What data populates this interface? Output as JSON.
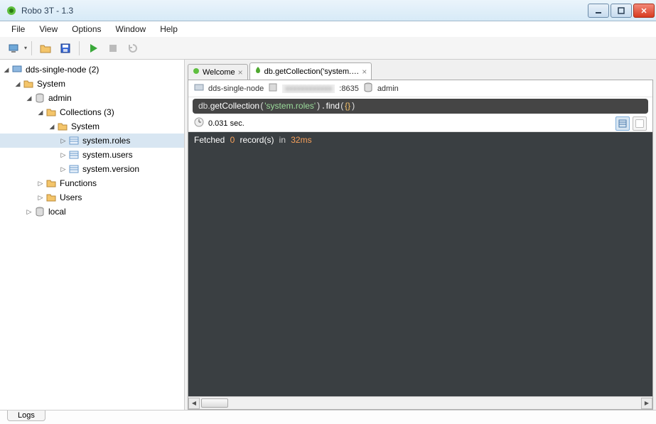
{
  "window": {
    "title": "Robo 3T - 1.3"
  },
  "menu": [
    "File",
    "View",
    "Options",
    "Window",
    "Help"
  ],
  "tree": {
    "root": {
      "label": "dds-single-node (2)"
    },
    "system": {
      "label": "System"
    },
    "admin": {
      "label": "admin"
    },
    "collections": {
      "label": "Collections (3)"
    },
    "system_folder": {
      "label": "System"
    },
    "coll_roles": {
      "label": "system.roles"
    },
    "coll_users": {
      "label": "system.users"
    },
    "coll_version": {
      "label": "system.version"
    },
    "functions": {
      "label": "Functions"
    },
    "users": {
      "label": "Users"
    },
    "local": {
      "label": "local"
    }
  },
  "tabs": {
    "welcome": "Welcome",
    "query": "db.getCollection('system.…"
  },
  "conn": {
    "host": "dds-single-node",
    "port": ":8635",
    "db": "admin"
  },
  "query": {
    "prefix": "db.",
    "fn": "getCollection",
    "arg": "'system.roles'",
    "fn2": "find",
    "arg2": "{}"
  },
  "status": {
    "time": "0.031 sec."
  },
  "result": {
    "word1": "Fetched",
    "num1": "0",
    "word2": "record(s)",
    "word3": "in",
    "num2": "32ms"
  },
  "bottom": {
    "logs": "Logs"
  }
}
